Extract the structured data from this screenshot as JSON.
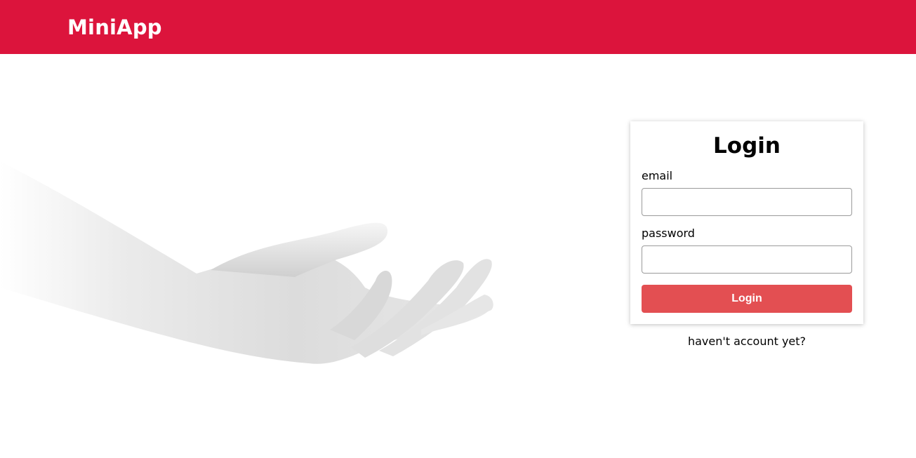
{
  "header": {
    "brand": "MiniApp",
    "background_color": "#dc143c"
  },
  "hero": {
    "image": "open-hand-illustration"
  },
  "login_form": {
    "title": "Login",
    "email_label": "email",
    "email_value": "",
    "password_label": "password",
    "password_value": "",
    "submit_label": "Login",
    "submit_color": "#e34f52"
  },
  "signup_link": {
    "text": "haven't account yet?"
  }
}
